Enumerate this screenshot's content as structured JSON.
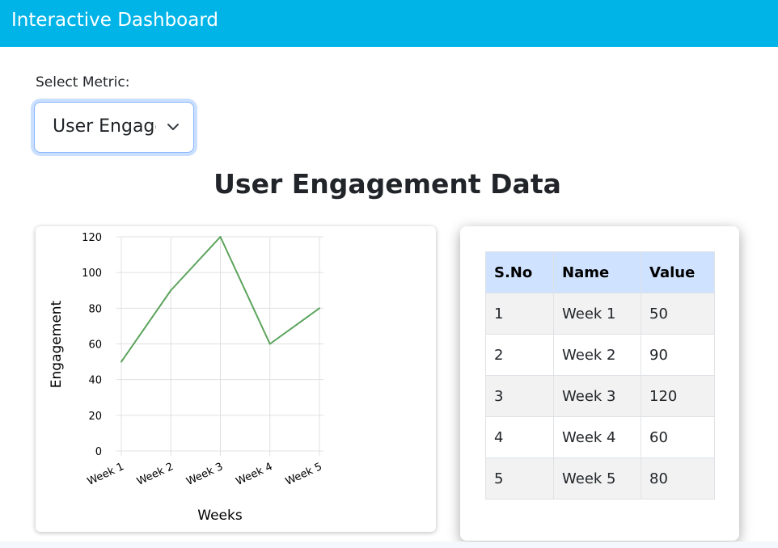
{
  "header": {
    "title": "Interactive Dashboard"
  },
  "metric_select": {
    "label": "Select Metric:",
    "value": "User Engagement"
  },
  "section": {
    "title": "User Engagement Data"
  },
  "table": {
    "headers": [
      "S.No",
      "Name",
      "Value"
    ],
    "rows": [
      [
        "1",
        "Week 1",
        "50"
      ],
      [
        "2",
        "Week 2",
        "90"
      ],
      [
        "3",
        "Week 3",
        "120"
      ],
      [
        "4",
        "Week 4",
        "60"
      ],
      [
        "5",
        "Week 5",
        "80"
      ]
    ]
  },
  "colors": {
    "header_bg": "#00b4e8",
    "line": "#5ba35b",
    "table_header_bg": "#cfe2ff"
  },
  "chart_data": {
    "type": "line",
    "categories": [
      "Week 1",
      "Week 2",
      "Week 3",
      "Week 4",
      "Week 5"
    ],
    "values": [
      50,
      90,
      120,
      60,
      80
    ],
    "xlabel": "Weeks",
    "ylabel": "Engagement",
    "ylim": [
      0,
      120
    ],
    "yticks": [
      0,
      20,
      40,
      60,
      80,
      100,
      120
    ],
    "grid": true,
    "legend": "none"
  }
}
